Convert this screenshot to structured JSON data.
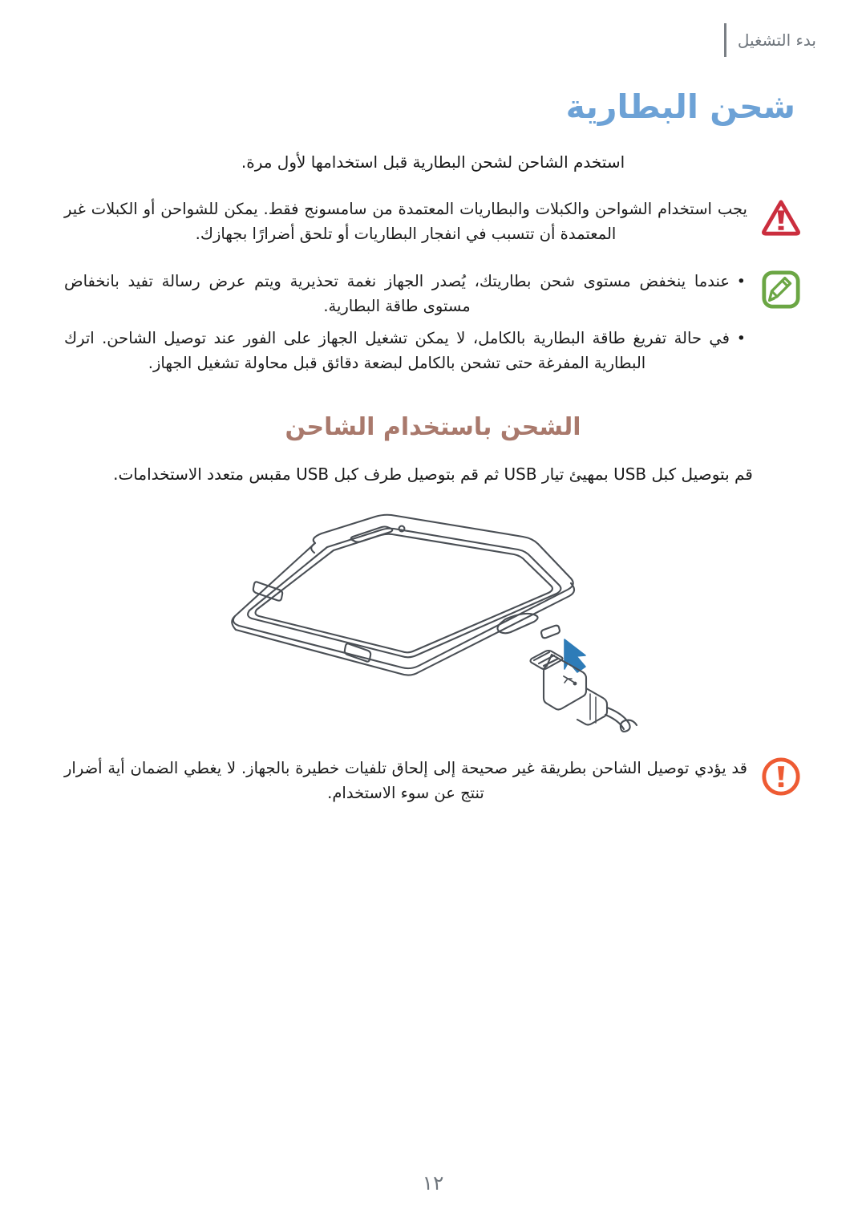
{
  "page": {
    "language": "ar",
    "direction": "rtl",
    "number": "١٢"
  },
  "header": {
    "running_title": "بدء التشغيل"
  },
  "chapter": {
    "title": "شحن البطارية",
    "intro": "استخدم الشاحن لشحن البطارية قبل استخدامها لأول مرة."
  },
  "callouts": [
    {
      "icon": "warning-triangle-icon",
      "icon_color": "#CB2E3E",
      "type": "warning",
      "text": "يجب استخدام الشواحن والكبلات والبطاريات المعتمدة من سامسونج فقط. يمكن للشواحن أو الكبلات غير المعتمدة أن تتسبب في انفجار البطاريات أو تلحق أضرارًا بجهازك."
    },
    {
      "icon": "note-pencil-icon",
      "icon_color": "#6BA644",
      "type": "note",
      "bullets": [
        "عندما ينخفض مستوى شحن بطاريتك، يُصدر الجهاز نغمة تحذيرية ويتم عرض رسالة تفيد بانخفاض مستوى طاقة البطارية.",
        "في حالة تفريغ طاقة البطارية بالكامل، لا يمكن تشغيل الجهاز على الفور عند توصيل الشاحن. اترك البطارية المفرغة حتى تشحن بالكامل لبضعة دقائق قبل محاولة تشغيل الجهاز."
      ]
    }
  ],
  "section": {
    "title": "الشحن باستخدام الشاحن",
    "step": "قم بتوصيل كبل USB بمهيئ تيار USB ثم قم بتوصيل طرف كبل USB مقبس متعدد الاستخدامات."
  },
  "illustration": {
    "name": "smartphone-usb-charging-diagram",
    "description": "رسم توضيحي لهاتف ذكي وكبل USB صغير مع سهم يشير إلى منفذ الشحن",
    "arrow_color": "#2E7CB8",
    "line_color": "#4a4f55"
  },
  "footer_callout": {
    "icon": "alert-circle-icon",
    "icon_color": "#EE5B33",
    "type": "caution",
    "text": "قد يؤدي توصيل الشاحن بطريقة غير صحيحة إلى إلحاق تلفيات خطيرة بالجهاز. لا يغطي الضمان أية أضرار تنتج عن سوء الاستخدام."
  }
}
